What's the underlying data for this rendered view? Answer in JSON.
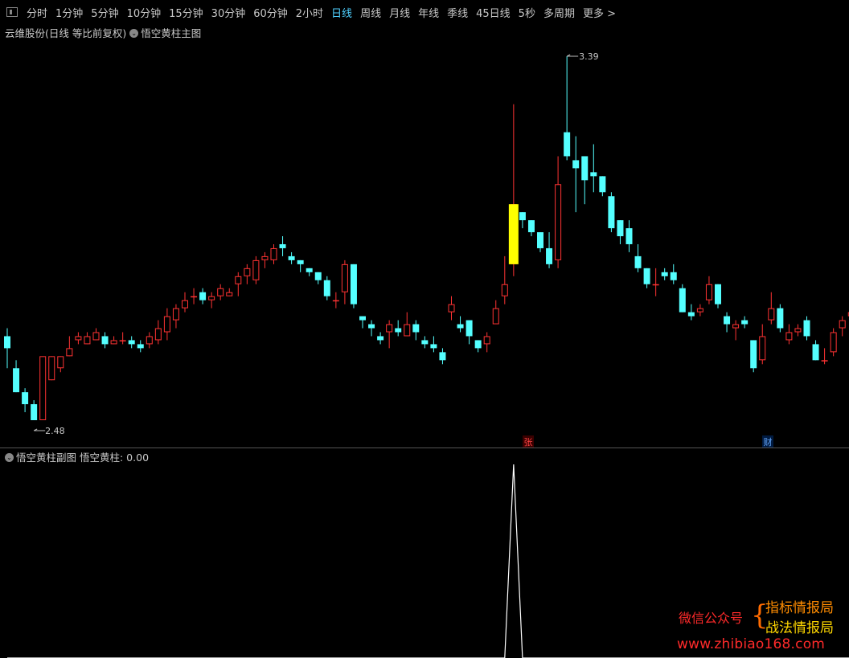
{
  "toolbar": {
    "tabs": [
      {
        "label": "分时"
      },
      {
        "label": "1分钟"
      },
      {
        "label": "5分钟"
      },
      {
        "label": "10分钟"
      },
      {
        "label": "15分钟"
      },
      {
        "label": "30分钟"
      },
      {
        "label": "60分钟"
      },
      {
        "label": "2小时"
      },
      {
        "label": "日线",
        "active": true
      },
      {
        "label": "周线"
      },
      {
        "label": "月线"
      },
      {
        "label": "年线"
      },
      {
        "label": "季线"
      },
      {
        "label": "45日线"
      },
      {
        "label": "5秒"
      },
      {
        "label": "多周期"
      },
      {
        "label": "更多 >"
      }
    ],
    "active_color": "#4fd0ff"
  },
  "main_panel": {
    "stock_label": "云维股份(日线 等比前复权)",
    "indicator_label": "悟空黄柱主图",
    "markers": {
      "zhang": "张",
      "cai": "财"
    }
  },
  "sub_panel": {
    "indicator_label": "悟空黄柱副图",
    "value_label": "悟空黄柱: 0.00"
  },
  "watermark": {
    "label": "微信公众号",
    "line1": "指标情报局",
    "line2": "战法情报局",
    "url": "www.zhibiao168.com"
  },
  "chart_data": {
    "type": "candlestick",
    "title": "",
    "colors": {
      "up": "#ff3333",
      "down": "#54ffff",
      "signal": "#ffff00",
      "indicator": "#ffffff"
    },
    "price_labels": {
      "high": "3.39",
      "low": "2.48"
    },
    "high_value": 3.39,
    "low_value": 2.48,
    "candles": [
      [
        2.69,
        2.66,
        2.71,
        2.61
      ],
      [
        2.61,
        2.55,
        2.63,
        2.55
      ],
      [
        2.55,
        2.52,
        2.56,
        2.5
      ],
      [
        2.52,
        2.48,
        2.53,
        2.48
      ],
      [
        2.48,
        2.64,
        2.64,
        2.48
      ],
      [
        2.58,
        2.64,
        2.64,
        2.58
      ],
      [
        2.61,
        2.64,
        2.64,
        2.6
      ],
      [
        2.64,
        2.66,
        2.69,
        2.64
      ],
      [
        2.68,
        2.69,
        2.7,
        2.67
      ],
      [
        2.67,
        2.69,
        2.7,
        2.67
      ],
      [
        2.68,
        2.7,
        2.71,
        2.68
      ],
      [
        2.69,
        2.67,
        2.7,
        2.66
      ],
      [
        2.67,
        2.68,
        2.69,
        2.67
      ],
      [
        2.68,
        2.68,
        2.7,
        2.67
      ],
      [
        2.68,
        2.67,
        2.69,
        2.66
      ],
      [
        2.67,
        2.66,
        2.68,
        2.65
      ],
      [
        2.67,
        2.69,
        2.7,
        2.66
      ],
      [
        2.68,
        2.71,
        2.73,
        2.67
      ],
      [
        2.7,
        2.74,
        2.76,
        2.68
      ],
      [
        2.73,
        2.76,
        2.77,
        2.71
      ],
      [
        2.76,
        2.78,
        2.8,
        2.75
      ],
      [
        2.79,
        2.79,
        2.81,
        2.77
      ],
      [
        2.8,
        2.78,
        2.81,
        2.77
      ],
      [
        2.78,
        2.79,
        2.8,
        2.76
      ],
      [
        2.79,
        2.81,
        2.82,
        2.78
      ],
      [
        2.79,
        2.8,
        2.81,
        2.79
      ],
      [
        2.82,
        2.84,
        2.85,
        2.79
      ],
      [
        2.84,
        2.86,
        2.87,
        2.82
      ],
      [
        2.83,
        2.88,
        2.89,
        2.82
      ],
      [
        2.88,
        2.89,
        2.9,
        2.86
      ],
      [
        2.88,
        2.91,
        2.92,
        2.87
      ],
      [
        2.92,
        2.91,
        2.94,
        2.89
      ],
      [
        2.89,
        2.88,
        2.9,
        2.87
      ],
      [
        2.88,
        2.87,
        2.88,
        2.85
      ],
      [
        2.86,
        2.85,
        2.86,
        2.84
      ],
      [
        2.85,
        2.83,
        2.85,
        2.82
      ],
      [
        2.83,
        2.79,
        2.84,
        2.78
      ],
      [
        2.78,
        2.78,
        2.8,
        2.76
      ],
      [
        2.8,
        2.87,
        2.88,
        2.77
      ],
      [
        2.87,
        2.77,
        2.87,
        2.76
      ],
      [
        2.74,
        2.73,
        2.74,
        2.71
      ],
      [
        2.72,
        2.71,
        2.73,
        2.69
      ],
      [
        2.69,
        2.68,
        2.7,
        2.67
      ],
      [
        2.7,
        2.72,
        2.73,
        2.66
      ],
      [
        2.71,
        2.7,
        2.73,
        2.69
      ],
      [
        2.69,
        2.72,
        2.75,
        2.69
      ],
      [
        2.72,
        2.7,
        2.73,
        2.68
      ],
      [
        2.68,
        2.67,
        2.69,
        2.66
      ],
      [
        2.67,
        2.66,
        2.69,
        2.65
      ],
      [
        2.65,
        2.63,
        2.66,
        2.62
      ],
      [
        2.75,
        2.77,
        2.79,
        2.73
      ],
      [
        2.72,
        2.71,
        2.74,
        2.7
      ],
      [
        2.73,
        2.69,
        2.73,
        2.67
      ],
      [
        2.68,
        2.66,
        2.68,
        2.65
      ],
      [
        2.67,
        2.69,
        2.7,
        2.65
      ],
      [
        2.72,
        2.76,
        2.78,
        2.72
      ],
      [
        2.79,
        2.82,
        2.89,
        2.77
      ],
      [
        2.87,
        3.02,
        3.27,
        2.84
      ],
      [
        3.0,
        2.98,
        3.0,
        2.96
      ],
      [
        2.98,
        2.95,
        2.98,
        2.94
      ],
      [
        2.95,
        2.91,
        2.95,
        2.9
      ],
      [
        2.91,
        2.87,
        2.95,
        2.86
      ],
      [
        2.88,
        3.07,
        3.14,
        2.86
      ],
      [
        3.2,
        3.14,
        3.39,
        3.13
      ],
      [
        3.13,
        3.11,
        3.19,
        3.0
      ],
      [
        3.14,
        3.08,
        3.13,
        3.02
      ],
      [
        3.1,
        3.09,
        3.17,
        3.05
      ],
      [
        3.09,
        3.05,
        3.09,
        3.04
      ],
      [
        3.04,
        2.96,
        3.05,
        2.95
      ],
      [
        2.98,
        2.94,
        2.98,
        2.92
      ],
      [
        2.96,
        2.92,
        2.98,
        2.9
      ],
      [
        2.89,
        2.86,
        2.92,
        2.85
      ],
      [
        2.86,
        2.82,
        2.86,
        2.81
      ],
      [
        2.82,
        2.82,
        2.86,
        2.79
      ],
      [
        2.85,
        2.84,
        2.86,
        2.83
      ],
      [
        2.85,
        2.83,
        2.87,
        2.82
      ],
      [
        2.81,
        2.75,
        2.82,
        2.75
      ],
      [
        2.75,
        2.74,
        2.77,
        2.73
      ],
      [
        2.75,
        2.76,
        2.77,
        2.74
      ],
      [
        2.78,
        2.82,
        2.84,
        2.77
      ],
      [
        2.82,
        2.77,
        2.82,
        2.76
      ],
      [
        2.74,
        2.72,
        2.75,
        2.7
      ],
      [
        2.71,
        2.72,
        2.73,
        2.68
      ],
      [
        2.73,
        2.72,
        2.74,
        2.71
      ],
      [
        2.68,
        2.61,
        2.68,
        2.6
      ],
      [
        2.63,
        2.69,
        2.72,
        2.62
      ],
      [
        2.73,
        2.76,
        2.8,
        2.72
      ],
      [
        2.76,
        2.71,
        2.77,
        2.7
      ],
      [
        2.68,
        2.7,
        2.72,
        2.67
      ],
      [
        2.7,
        2.71,
        2.72,
        2.69
      ],
      [
        2.73,
        2.69,
        2.74,
        2.68
      ],
      [
        2.67,
        2.63,
        2.68,
        2.63
      ],
      [
        2.63,
        2.63,
        2.66,
        2.62
      ],
      [
        2.65,
        2.7,
        2.71,
        2.64
      ],
      [
        2.71,
        2.73,
        2.74,
        2.69
      ],
      [
        2.74,
        2.75,
        2.76,
        2.72
      ]
    ],
    "signal_index": 57,
    "indicator_values": [
      0,
      0,
      0,
      0,
      0,
      0,
      0,
      0,
      0,
      0,
      0,
      0,
      0,
      0,
      0,
      0,
      0,
      0,
      0,
      0,
      0,
      0,
      0,
      0,
      0,
      0,
      0,
      0,
      0,
      0,
      0,
      0,
      0,
      0,
      0,
      0,
      0,
      0,
      0,
      0,
      0,
      0,
      0,
      0,
      0,
      0,
      0,
      0,
      0,
      0,
      0,
      0,
      0,
      0,
      0,
      0,
      0,
      1,
      0,
      0,
      0,
      0,
      0,
      0,
      0,
      0,
      0,
      0,
      0,
      0,
      0,
      0,
      0,
      0,
      0,
      0,
      0,
      0,
      0,
      0,
      0,
      0,
      0,
      0,
      0,
      0,
      0,
      0,
      0,
      0,
      0,
      0,
      0,
      0,
      0,
      0
    ]
  }
}
